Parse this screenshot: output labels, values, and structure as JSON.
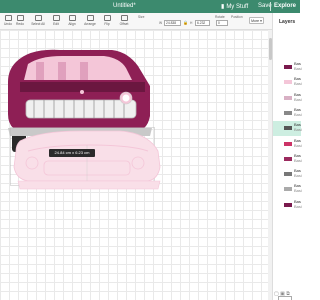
{
  "app": {
    "title": "Untitled*",
    "my_stuff": "My Stuff",
    "save": "Save",
    "explore": "Explore"
  },
  "toolbar": {
    "items": [
      {
        "label": "Undo",
        "icon": "undo-icon"
      },
      {
        "label": "Redo",
        "icon": "redo-icon"
      },
      {
        "label": "Select All",
        "icon": "select-all-icon"
      },
      {
        "label": "Edit",
        "icon": "edit-icon"
      },
      {
        "label": "Align",
        "icon": "align-icon"
      },
      {
        "label": "Arrange",
        "icon": "arrange-icon"
      },
      {
        "label": "Flip",
        "icon": "flip-icon"
      },
      {
        "label": "Offset",
        "icon": "offset-icon"
      }
    ],
    "size_label": "Size",
    "width_label": "W",
    "width_value": "24.838",
    "height_label": "H",
    "height_value": "6.232",
    "rotate_label": "Rotate",
    "rotate_value": "0",
    "position_label": "Position",
    "more_label": "More ▾"
  },
  "tooltip": {
    "size_text": "24.84 cm x 6.23 cm"
  },
  "layers": {
    "title": "Layers",
    "items": [
      {
        "name": "Bas",
        "sub": "Basi",
        "color": "#7a1a4d",
        "selected": false
      },
      {
        "name": "Bas",
        "sub": "Basi",
        "color": "#f4c6d8",
        "selected": false
      },
      {
        "name": "Bas",
        "sub": "Basi",
        "color": "#d8b0c4",
        "selected": false
      },
      {
        "name": "Bas",
        "sub": "Basi",
        "color": "#888888",
        "selected": false
      },
      {
        "name": "Bas",
        "sub": "Basi",
        "color": "#555555",
        "selected": true
      },
      {
        "name": "Bas",
        "sub": "Basi",
        "color": "#cc3366",
        "selected": false
      },
      {
        "name": "Bas",
        "sub": "Basi",
        "color": "#9b2a5e",
        "selected": false
      },
      {
        "name": "Bas",
        "sub": "Basi",
        "color": "#777777",
        "selected": false
      },
      {
        "name": "Bas",
        "sub": "Basi",
        "color": "#aaaaaa",
        "selected": false
      },
      {
        "name": "Bas",
        "sub": "Basi",
        "color": "#7a1a4d",
        "selected": false
      }
    ]
  },
  "colors": {
    "accent": "#3c8a6e",
    "car_body": "#8e1f55",
    "car_outline": "#f4c6d8"
  }
}
